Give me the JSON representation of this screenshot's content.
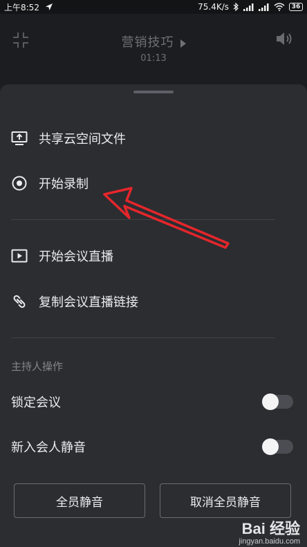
{
  "status_bar": {
    "time": "上午8:52",
    "network_speed": "75.4K/s",
    "battery": "36"
  },
  "header": {
    "title": "营销技巧",
    "timer": "01:13"
  },
  "menu": {
    "items": [
      {
        "label": "共享云空间文件",
        "icon": "share-screen-icon"
      },
      {
        "label": "开始录制",
        "icon": "record-icon"
      },
      {
        "label": "开始会议直播",
        "icon": "live-icon"
      },
      {
        "label": "复制会议直播链接",
        "icon": "link-icon"
      }
    ]
  },
  "host_section": {
    "title": "主持人操作",
    "toggles": [
      {
        "label": "锁定会议",
        "on": false
      },
      {
        "label": "新入会人静音",
        "on": false
      }
    ]
  },
  "buttons": {
    "mute_all": "全员静音",
    "unmute_all": "取消全员静音"
  },
  "colors": {
    "sheet_bg": "#2b2d31",
    "page_bg": "#1c1d20",
    "arrow": "#e5262b"
  },
  "watermark": {
    "logo": "Bai 经验",
    "url": "jingyan.baidu.com"
  }
}
